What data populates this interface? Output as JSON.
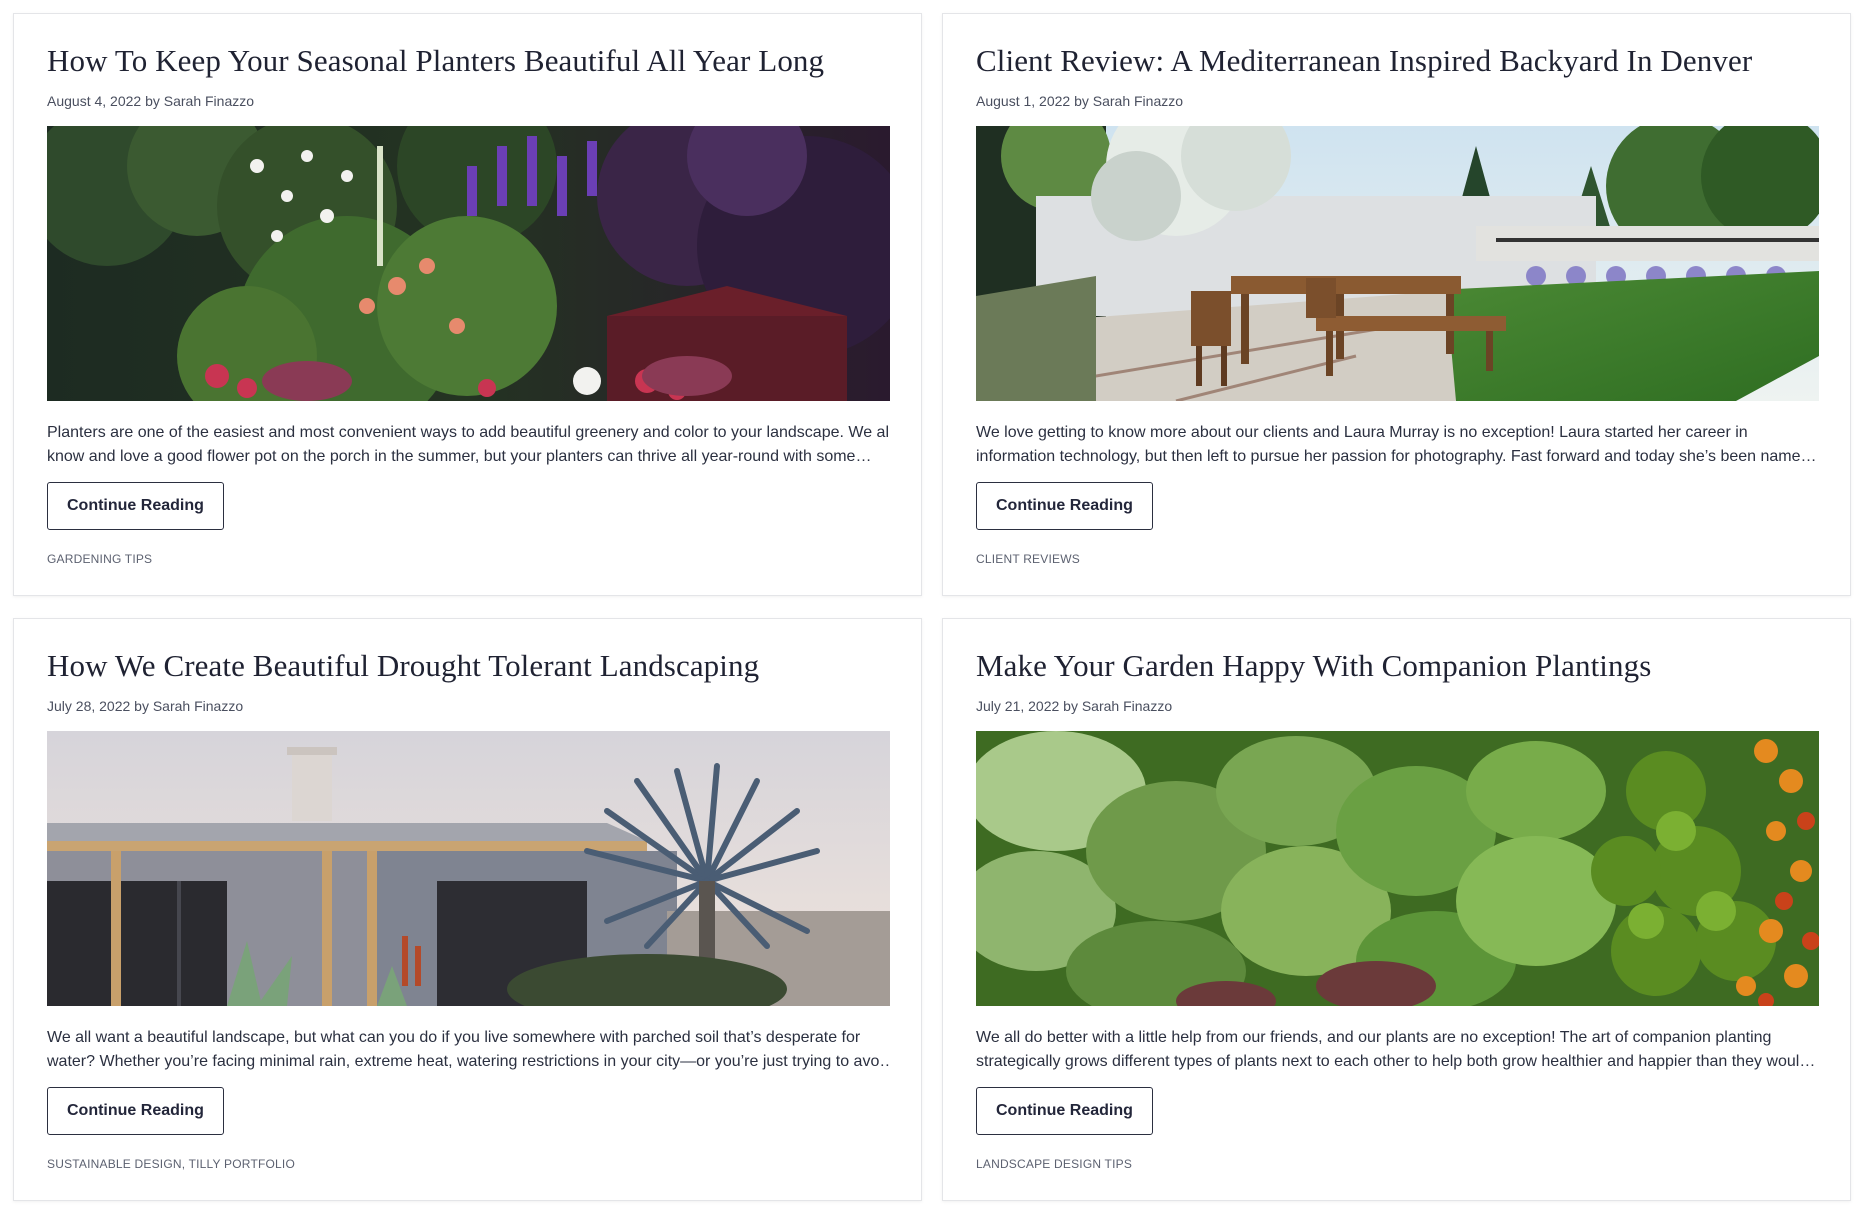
{
  "posts": [
    {
      "title": "How To Keep Your Seasonal Planters Beautiful All Year Long",
      "meta": "August 4, 2022 by Sarah Finazzo",
      "image": "planter-flowers-photo",
      "excerpt": [
        "Planters are one of the easiest and most convenient ways to add beautiful greenery and color to your landscape. We all",
        "know and love a good flower pot on the porch in the summer, but your planters can thrive all year-round with some…"
      ],
      "button": "Continue Reading",
      "categories": [
        "GARDENING TIPS"
      ]
    },
    {
      "title": "Client Review: A Mediterranean Inspired Backyard In Denver",
      "meta": "August 1, 2022 by Sarah Finazzo",
      "image": "backyard-patio-rendering",
      "excerpt": [
        "We love getting to know more about our clients and Laura Murray is no exception! Laura started her career in",
        "information technology, but then left to pursue her passion for photography. Fast forward and today she’s been name…"
      ],
      "button": "Continue Reading",
      "categories": [
        "CLIENT REVIEWS"
      ]
    },
    {
      "title": "How We Create Beautiful Drought Tolerant Landscaping",
      "meta": "July 28, 2022 by Sarah Finazzo",
      "image": "drought-tolerant-house-rendering",
      "excerpt": [
        "We all want a beautiful landscape, but what can you do if you live somewhere with parched soil that’s desperate for",
        "water? Whether you’re facing minimal rain, extreme heat, watering restrictions in your city—or you’re just trying to avo…"
      ],
      "button": "Continue Reading",
      "categories": [
        "SUSTAINABLE DESIGN",
        "TILLY PORTFOLIO"
      ]
    },
    {
      "title": "Make Your Garden Happy With Companion Plantings",
      "meta": "July 21, 2022 by Sarah Finazzo",
      "image": "companion-plantings-photo",
      "excerpt": [
        "We all do better with a little help from our friends, and our plants are no exception! The art of companion planting",
        "strategically grows different types of plants next to each other to help both grow healthier and happier than they woul…"
      ],
      "button": "Continue Reading",
      "categories": [
        "LANDSCAPE DESIGN TIPS"
      ]
    }
  ],
  "colors": {
    "title": "#1f2232",
    "body_text": "#2b3040",
    "meta_text": "#4a4f5f",
    "card_border": "#e4e5e8",
    "button_border": "#2b2f40"
  }
}
